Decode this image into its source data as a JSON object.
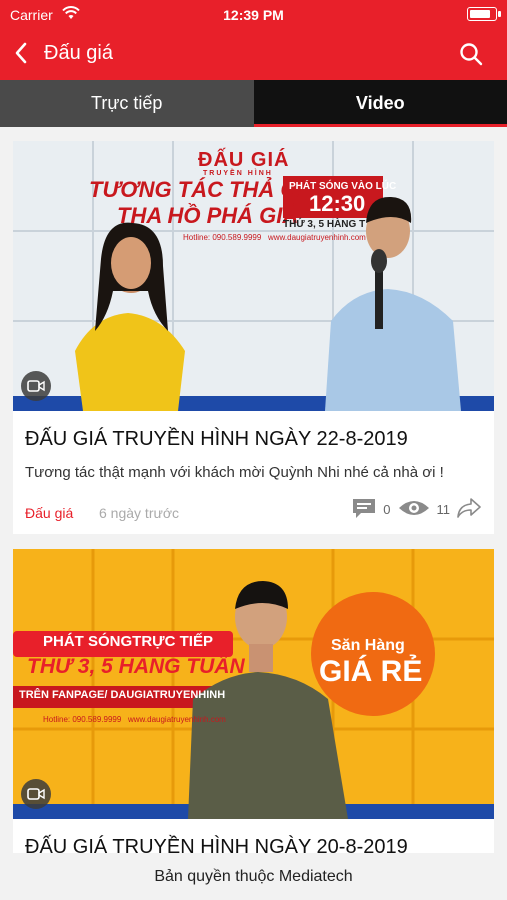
{
  "status_bar": {
    "carrier": "Carrier",
    "time": "12:39 PM"
  },
  "navbar": {
    "title": "Đấu giá"
  },
  "tabs": [
    {
      "label": "Trực tiếp",
      "active": false
    },
    {
      "label": "Video",
      "active": true
    }
  ],
  "videos": [
    {
      "title": "ĐẤU GIÁ TRUYỀN HÌNH NGÀY 22-8-2019",
      "description": "Tương tác thật mạnh với khách mời Quỳnh Nhi nhé cả nhà ơi !",
      "category": "Đấu giá",
      "time_ago": "6 ngày trước",
      "comments": "0",
      "views": "11",
      "thumbnail": {
        "logo": "ĐẤU GIÁ",
        "logo_sub": "TRUYỀN HÌNH",
        "line1": "TƯƠNG TÁC THẢ GA",
        "line2": "THA HỒ PHÁ GIÁ",
        "broadcast": "PHÁT SÓNG VÀO LÚC",
        "clock": "12:30",
        "days": "THỨ 3, 5 HÀNG T",
        "hotline": "Hotline: 090.589.9999",
        "website": "www.daugiatruyenhinh.com"
      }
    },
    {
      "title": "ĐẤU GIÁ TRUYỀN HÌNH NGÀY 20-8-2019",
      "thumbnail": {
        "line1": "PHÁT SÓNGTRỰC TIẾP",
        "line2": "THỨ 3, 5 HÀNG TUẦN",
        "line3": "TRÊN FANPAGE/ DAUGIATRUYENHINH",
        "hotline": "Hotline: 090.589.9999",
        "website": "www.daugiatruyenhinh.com",
        "promo_top": "Săn Hàng",
        "promo_big": "GIÁ RẺ"
      }
    }
  ],
  "footer": {
    "text": "Bản quyền thuộc Mediatech"
  },
  "colors": {
    "brand_red": "#e8202a",
    "tab_inactive": "#4a4a4a",
    "tab_active": "#111111"
  }
}
